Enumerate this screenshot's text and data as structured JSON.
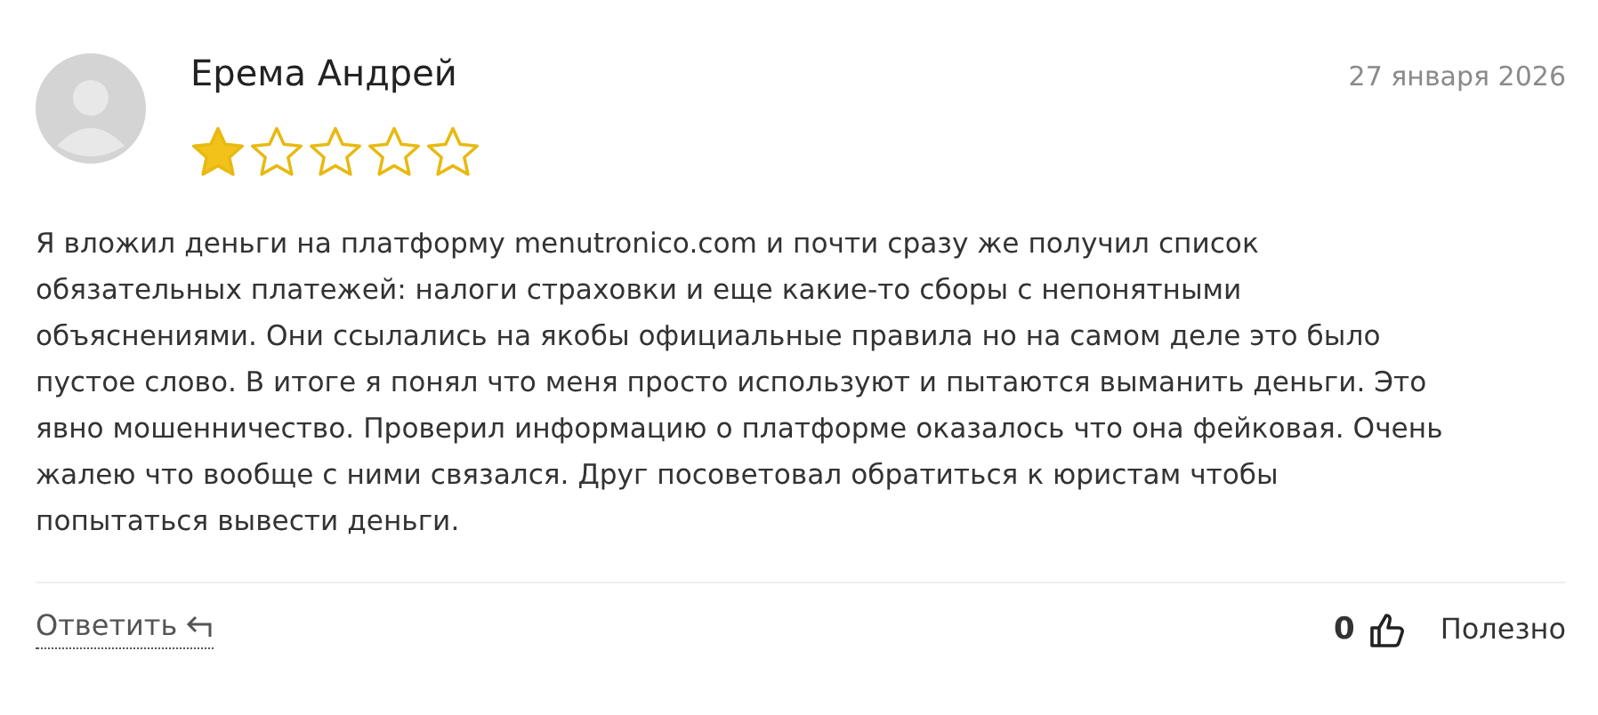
{
  "review": {
    "author": "Ерема Андрей",
    "date": "27 января 2026",
    "stars": 1,
    "text": "Я вложил деньги на платформу menutronico.com и почти сразу же получил список обязательных платежей: налоги страховки и еще какие-то сборы с непонятными объяснениями. Они ссылались на якобы официальные правила но на самом деле это было пустое слово. В итоге я понял что меня просто используют и пытаются выманить деньги. Это явно мошенничество. Проверил информацию о платформе оказалось что она фейковая. Очень жалею что вообще с ними связался. Друг посоветовал обратиться к юристам чтобы попытаться вывести деньги.",
    "reply_label": "Ответить",
    "likes": "0",
    "helpful_label": "Полезно"
  }
}
